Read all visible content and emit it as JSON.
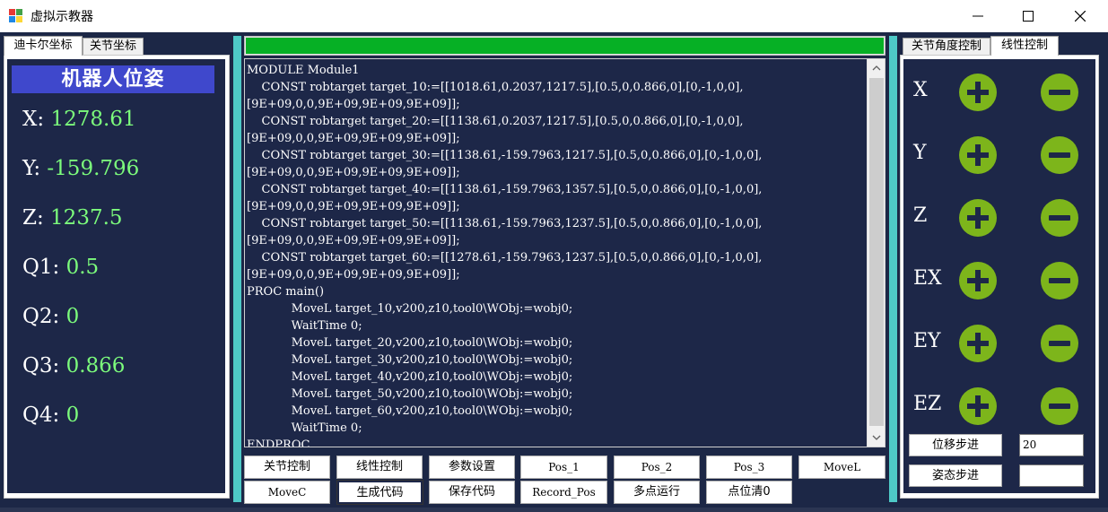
{
  "window": {
    "title": "虚拟示教器",
    "icon": "app-icon"
  },
  "left_tabs": [
    {
      "label": "迪卡尔坐标",
      "active": true
    },
    {
      "label": "关节坐标",
      "active": false
    }
  ],
  "pose": {
    "header": "机器人位姿",
    "rows": [
      {
        "label": "X:",
        "value": "1278.61"
      },
      {
        "label": "Y:",
        "value": "-159.796"
      },
      {
        "label": "Z:",
        "value": "1237.5"
      },
      {
        "label": "Q1:",
        "value": "0.5"
      },
      {
        "label": "Q2:",
        "value": "0"
      },
      {
        "label": "Q3:",
        "value": "0.866"
      },
      {
        "label": "Q4:",
        "value": "0"
      }
    ]
  },
  "progress": {
    "fraction": 1.0,
    "color": "#06b025"
  },
  "code": {
    "lines": [
      "MODULE Module1",
      "    CONST robtarget target_10:=[[1018.61,0.2037,1217.5],[0.5,0,0.866,0],[0,-1,0,0],",
      "[9E+09,0,0,9E+09,9E+09,9E+09]];",
      "    CONST robtarget target_20:=[[1138.61,0.2037,1217.5],[0.5,0,0.866,0],[0,-1,0,0],",
      "[9E+09,0,0,9E+09,9E+09,9E+09]];",
      "    CONST robtarget target_30:=[[1138.61,-159.7963,1217.5],[0.5,0,0.866,0],[0,-1,0,0],",
      "[9E+09,0,0,9E+09,9E+09,9E+09]];",
      "    CONST robtarget target_40:=[[1138.61,-159.7963,1357.5],[0.5,0,0.866,0],[0,-1,0,0],",
      "[9E+09,0,0,9E+09,9E+09,9E+09]];",
      "    CONST robtarget target_50:=[[1138.61,-159.7963,1237.5],[0.5,0,0.866,0],[0,-1,0,0],",
      "[9E+09,0,0,9E+09,9E+09,9E+09]];",
      "    CONST robtarget target_60:=[[1278.61,-159.7963,1237.5],[0.5,0,0.866,0],[0,-1,0,0],",
      "[9E+09,0,0,9E+09,9E+09,9E+09]];",
      "PROC main()",
      "            MoveL target_10,v200,z10,tool0\\WObj:=wobj0;",
      "            WaitTime 0;",
      "            MoveL target_20,v200,z10,tool0\\WObj:=wobj0;",
      "            MoveL target_30,v200,z10,tool0\\WObj:=wobj0;",
      "            MoveL target_40,v200,z10,tool0\\WObj:=wobj0;",
      "            MoveL target_50,v200,z10,tool0\\WObj:=wobj0;",
      "            MoveL target_60,v200,z10,tool0\\WObj:=wobj0;",
      "            WaitTime 0;",
      "ENDPROC"
    ]
  },
  "buttons": {
    "row1": [
      "关节控制",
      "线性控制",
      "参数设置",
      "Pos_1",
      "Pos_2",
      "Pos_3",
      "MoveL"
    ],
    "row2": [
      "MoveC",
      "生成代码",
      "保存代码",
      "Record_Pos",
      "多点运行",
      "点位清0"
    ],
    "selected": "生成代码"
  },
  "right_tabs": [
    {
      "label": "关节角度控制",
      "active": false
    },
    {
      "label": "线性控制",
      "active": true
    }
  ],
  "axes": [
    "X",
    "Y",
    "Z",
    "EX",
    "EY",
    "EZ"
  ],
  "step": {
    "displacement_label": "位移步进",
    "displacement_value": "20",
    "attitude_label": "姿态步进",
    "attitude_value": ""
  },
  "colors": {
    "background": "#1c2746",
    "pose_header": "#3f48cc",
    "pose_value": "#7cfc7c",
    "accent_green": "#7db51b",
    "cyan": "#4ec9c7"
  }
}
